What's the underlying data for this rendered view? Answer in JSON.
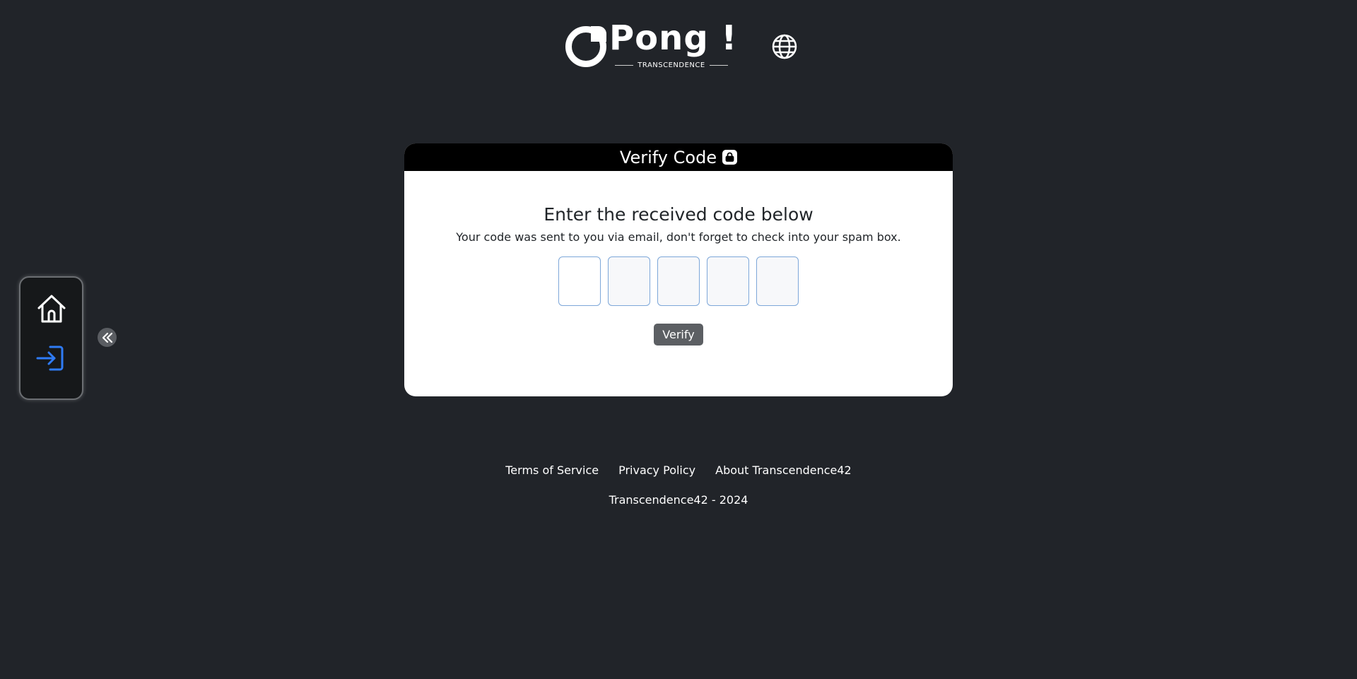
{
  "header": {
    "logo_text": "Pong !",
    "logo_subtitle": "TRANSCENDENCE",
    "language_icon": "globe-icon"
  },
  "sidenav": {
    "items": [
      {
        "icon": "home-icon",
        "color": "#ffffff"
      },
      {
        "icon": "login-icon",
        "color": "#2f7bf5",
        "active": true
      }
    ],
    "collapse_icon": "double-chevron-left-icon"
  },
  "card": {
    "title": "Verify Code",
    "title_icon": "lock-icon",
    "heading": "Enter the received code below",
    "description": "Your code was sent to you via email, don't forget to check into your spam box.",
    "code_inputs": [
      "",
      "",
      "",
      "",
      ""
    ],
    "verify_label": "Verify"
  },
  "footer": {
    "links": [
      "Terms of Service",
      "Privacy Policy",
      "About Transcendence42"
    ],
    "copyright": "Transcendence42 - 2024"
  },
  "colors": {
    "background": "#212429",
    "accent": "#2f7bf5",
    "card_header": "#000000",
    "button": "#5c5f63"
  }
}
